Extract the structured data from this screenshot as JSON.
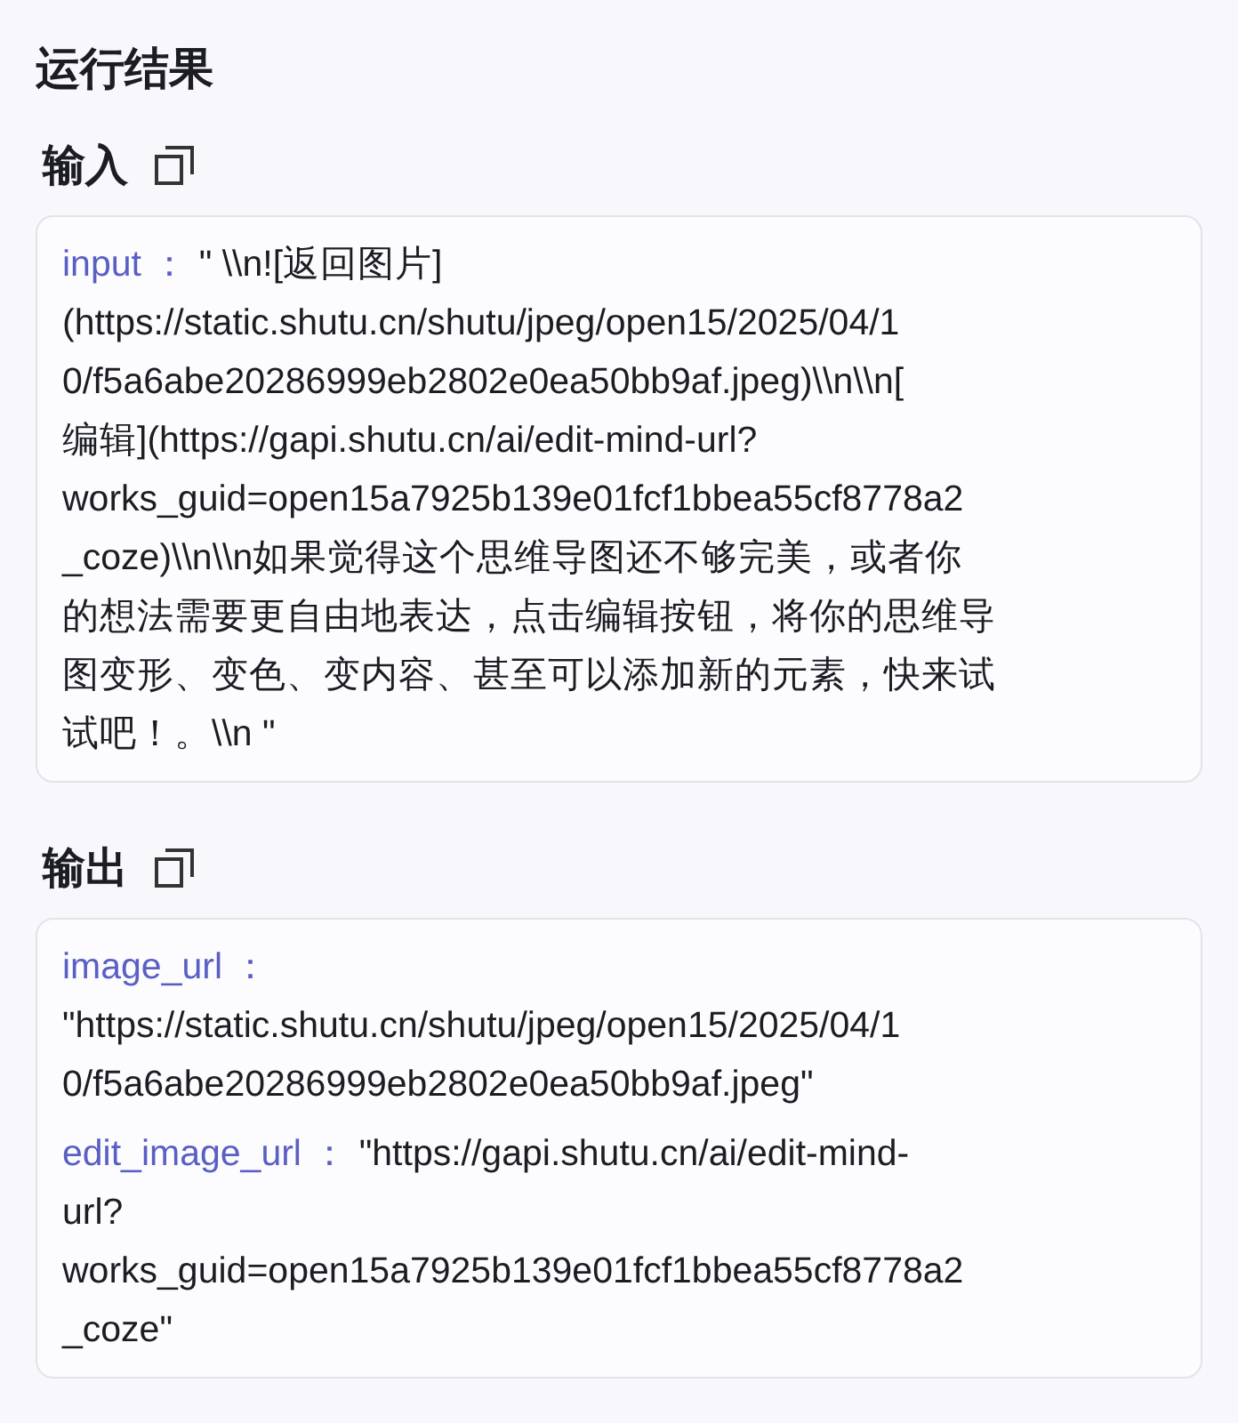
{
  "title": "运行结果",
  "sections": [
    {
      "label": "输入",
      "entries": [
        {
          "key": "input",
          "separator": "：",
          "lines": [
            "\" \\\\n![返回图片]",
            "(https://static.shutu.cn/shutu/jpeg/open15/2025/04/1",
            "0/f5a6abe20286999eb2802e0ea50bb9af.jpeg)\\\\n\\\\n[",
            "编辑](https://gapi.shutu.cn/ai/edit-mind-url?",
            "works_guid=open15a7925b139e01fcf1bbea55cf8778a2",
            "_coze)\\\\n\\\\n如果觉得这个思维导图还不够完美，或者你",
            "的想法需要更自由地表达，点击编辑按钮，将你的思维导",
            "图变形、变色、变内容、甚至可以添加新的元素，快来试",
            "试吧！。\\\\n \""
          ]
        }
      ]
    },
    {
      "label": "输出",
      "entries": [
        {
          "key": "image_url",
          "separator": "：",
          "break_after_key": true,
          "lines": [
            "\"https://static.shutu.cn/shutu/jpeg/open15/2025/04/1",
            "0/f5a6abe20286999eb2802e0ea50bb9af.jpeg\""
          ]
        },
        {
          "key": "edit_image_url",
          "separator": "：",
          "lines": [
            "\"https://gapi.shutu.cn/ai/edit-mind-",
            "url?",
            "works_guid=open15a7925b139e01fcf1bbea55cf8778a2",
            "_coze\""
          ]
        }
      ]
    }
  ]
}
